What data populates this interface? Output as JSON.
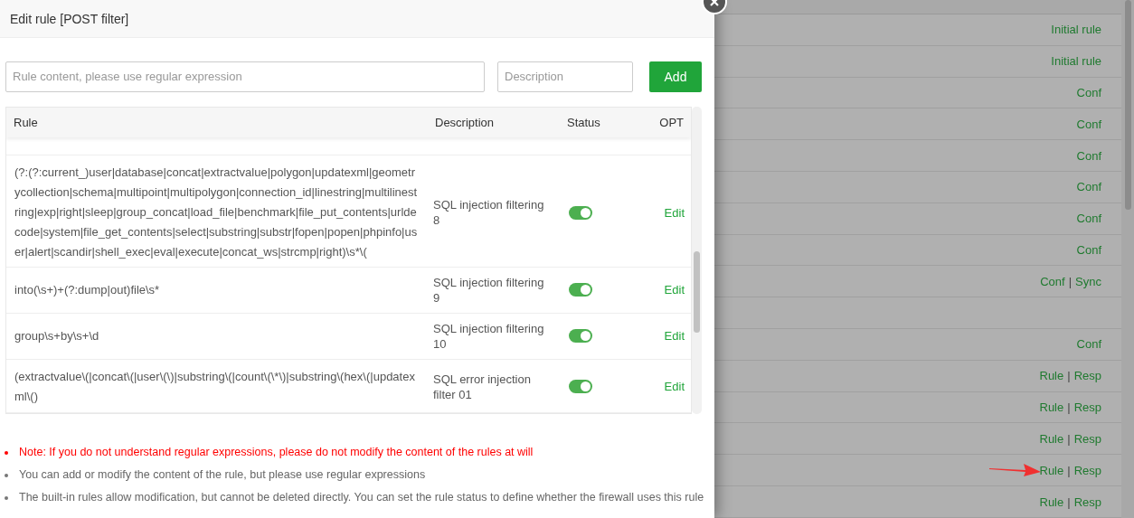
{
  "dialog": {
    "title": "Edit rule [POST filter]",
    "rule_field": {
      "placeholder": "Rule content, please use regular expression"
    },
    "description_field": {
      "placeholder": "Description"
    },
    "add_button": "Add",
    "table": {
      "columns": [
        "Rule",
        "Description",
        "Status",
        "OPT"
      ],
      "rows": [
        {
          "rule": "(?:(?:current_)user|database|concat|extractvalue|polygon|updatexml|geometrycollection|schema|multipoint|multipolygon|connection_id|linestring|multilinestring|exp|right|sleep|group_concat|load_file|benchmark|file_put_contents|urldecode|system|file_get_contents|select|substring|substr|fopen|popen|phpinfo|user|alert|scandir|shell_exec|eval|execute|concat_ws|strcmp|right)\\s*\\(",
          "description": "SQL injection filtering 8",
          "on": true,
          "action": "Edit"
        },
        {
          "rule": "into(\\s+)+(?:dump|out)file\\s*",
          "description": "SQL injection filtering 9",
          "on": true,
          "action": "Edit"
        },
        {
          "rule": "group\\s+by\\s+\\d",
          "description": "SQL injection filtering 10",
          "on": true,
          "action": "Edit"
        },
        {
          "rule": "(extractvalue\\(|concat\\(|user\\(\\)|substring\\(|count\\(\\*\\)|substring\\(hex\\(|updatexml\\()",
          "description": "SQL error injection filter 01",
          "on": true,
          "action": "Edit"
        }
      ]
    },
    "notes": [
      {
        "kind": "warning",
        "text": "Note: If you do not understand regular expressions, please do not modify the content of the rules at will"
      },
      {
        "kind": "info",
        "text": "You can add or modify the content of the rule, but please use regular expressions"
      },
      {
        "kind": "info",
        "text": "The built-in rules allow modification, but cannot be deleted directly. You can set the rule status to define whether the firewall uses this rule"
      }
    ]
  },
  "background_table": {
    "separator": "|",
    "rows": [
      {
        "links": [
          "Initial rule"
        ],
        "pointer": false
      },
      {
        "links": [
          "Initial rule"
        ],
        "pointer": false
      },
      {
        "links": [
          "Conf"
        ],
        "pointer": false
      },
      {
        "links": [
          "Conf"
        ],
        "pointer": false
      },
      {
        "links": [
          "Conf"
        ],
        "pointer": false
      },
      {
        "links": [
          "Conf"
        ],
        "pointer": false
      },
      {
        "links": [
          "Conf"
        ],
        "pointer": false
      },
      {
        "links": [
          "Conf"
        ],
        "pointer": false
      },
      {
        "links": [
          "Conf",
          "Sync"
        ],
        "pointer": false
      },
      {
        "links": [],
        "pointer": false
      },
      {
        "links": [
          "Conf"
        ],
        "pointer": false
      },
      {
        "links": [
          "Rule",
          "Resp"
        ],
        "pointer": false
      },
      {
        "links": [
          "Rule",
          "Resp"
        ],
        "pointer": false
      },
      {
        "links": [
          "Rule",
          "Resp"
        ],
        "pointer": false
      },
      {
        "links": [
          "Rule",
          "Resp"
        ],
        "pointer": true
      },
      {
        "links": [
          "Rule",
          "Resp"
        ],
        "pointer": false
      }
    ]
  }
}
